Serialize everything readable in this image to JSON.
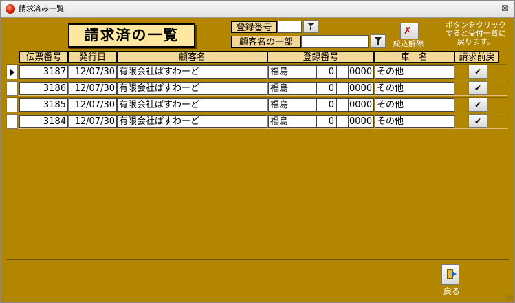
{
  "window": {
    "title": "請求済み一覧",
    "close_glyph": "☒"
  },
  "page_title": "請求済の一覧",
  "filters": {
    "reg_no_label": "登録番号",
    "reg_no_value": "",
    "customer_part_label": "顧客名の一部",
    "customer_part_value": "",
    "clear_label": "絞込解除",
    "hint": "ボタンをクリックすると受付一覧に戻ります。"
  },
  "columns": [
    "伝票番号",
    "発行日",
    "顧客名",
    "登録番号",
    "車　名",
    "請求前戻"
  ],
  "rows": [
    {
      "slip": "3187",
      "date": "12/07/30",
      "customer": "有限会社ぱすわーど",
      "reg_area": "福島",
      "reg_class": "0",
      "reg_kana": "",
      "reg_num": "0000",
      "car": "その他",
      "action": "✔"
    },
    {
      "slip": "3186",
      "date": "12/07/30",
      "customer": "有限会社ぱすわーど",
      "reg_area": "福島",
      "reg_class": "0",
      "reg_kana": "",
      "reg_num": "0000",
      "car": "その他",
      "action": "✔"
    },
    {
      "slip": "3185",
      "date": "12/07/30",
      "customer": "有限会社ぱすわーど",
      "reg_area": "福島",
      "reg_class": "0",
      "reg_kana": "",
      "reg_num": "0000",
      "car": "その他",
      "action": "✔"
    },
    {
      "slip": "3184",
      "date": "12/07/30",
      "customer": "有限会社ぱすわーど",
      "reg_area": "福島",
      "reg_class": "0",
      "reg_kana": "",
      "reg_num": "0000",
      "car": "その他",
      "action": "✔"
    }
  ],
  "footer": {
    "back_label": "戻る"
  },
  "icons": {
    "app": "app-red-ball-icon",
    "filter": "funnel-icon",
    "clear": "filter-clear-icon",
    "back": "exit-door-icon",
    "current_row": "record-pointer-icon"
  },
  "colors": {
    "background": "#b38600",
    "header_fill": "#f3d89a",
    "title_fill": "#ffe7a0"
  }
}
